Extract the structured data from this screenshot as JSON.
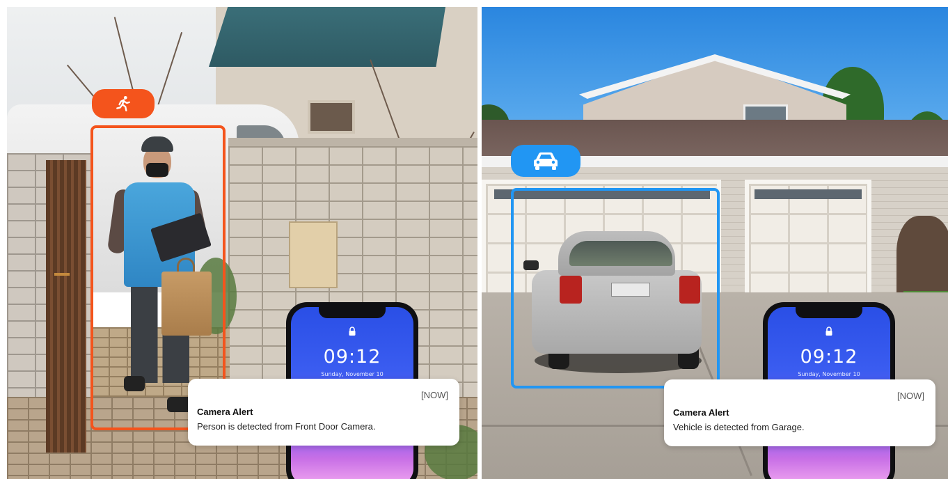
{
  "colors": {
    "person_accent": "#f4541c",
    "vehicle_accent": "#2196f3",
    "card_background": "#ffffff"
  },
  "panels": [
    {
      "scene": "front-door",
      "detection": {
        "icon": "running-person-icon"
      },
      "phone": {
        "time": "09:12",
        "date": "Sunday, November 10",
        "icon": "lock-icon"
      },
      "notification": {
        "timestamp": "[NOW]",
        "title": "Camera Alert",
        "message": "Person is detected from Front Door Camera."
      }
    },
    {
      "scene": "garage",
      "detection": {
        "icon": "car-icon"
      },
      "phone": {
        "time": "09:12",
        "date": "Sunday, November 10",
        "icon": "lock-icon"
      },
      "notification": {
        "timestamp": "[NOW]",
        "title": "Camera Alert",
        "message": "Vehicle is detected from Garage."
      }
    }
  ]
}
